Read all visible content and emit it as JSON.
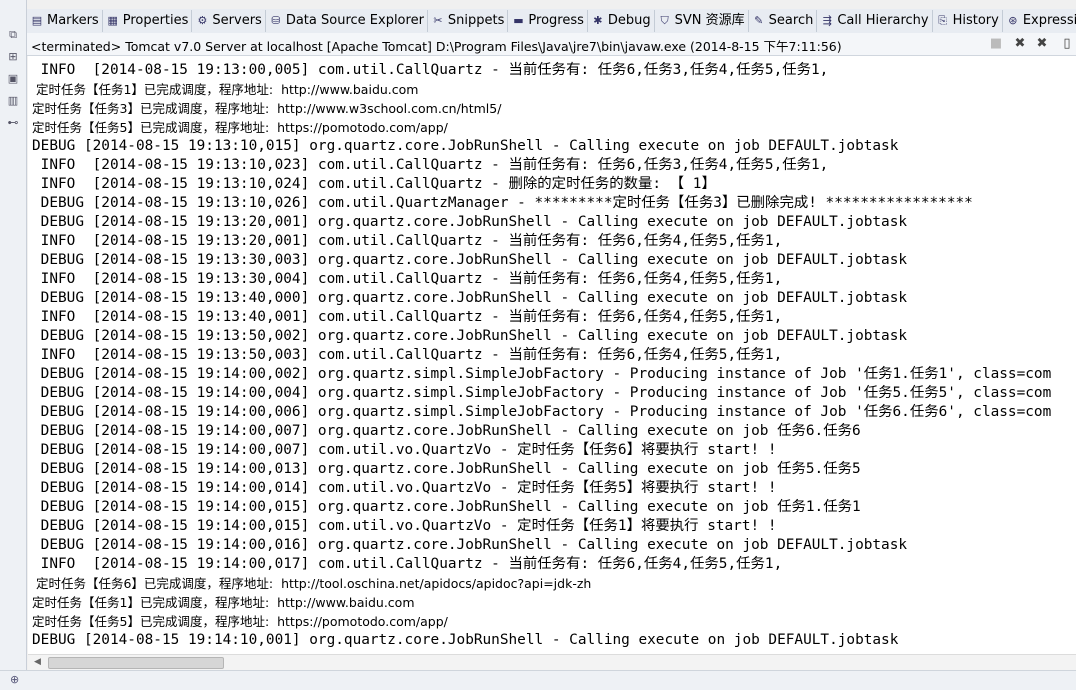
{
  "tabs": [
    {
      "label": "Markers",
      "icon": "markers-icon",
      "glyph": "▤"
    },
    {
      "label": "Properties",
      "icon": "properties-icon",
      "glyph": "▦"
    },
    {
      "label": "Servers",
      "icon": "servers-icon",
      "glyph": "⚙"
    },
    {
      "label": "Data Source Explorer",
      "icon": "database-icon",
      "glyph": "⛁"
    },
    {
      "label": "Snippets",
      "icon": "snippets-icon",
      "glyph": "✂"
    },
    {
      "label": "Progress",
      "icon": "progress-icon",
      "glyph": "▬"
    },
    {
      "label": "Debug",
      "icon": "debug-icon",
      "glyph": "✱"
    },
    {
      "label": "SVN 资源库",
      "icon": "svn-icon",
      "glyph": "⛉"
    },
    {
      "label": "Search",
      "icon": "search-icon",
      "glyph": "✎"
    },
    {
      "label": "Call Hierarchy",
      "icon": "call-hierarchy-icon",
      "glyph": "⇶"
    },
    {
      "label": "History",
      "icon": "history-icon",
      "glyph": "⎘"
    },
    {
      "label": "Expressions",
      "icon": "expressions-icon",
      "glyph": "⊛"
    }
  ],
  "console_title": "<terminated> Tomcat v7.0 Server at localhost [Apache Tomcat] D:\\Program Files\\Java\\jre7\\bin\\javaw.exe (2014-8-15 下午7:11:56)",
  "log_lines": [
    " INFO  [2014-08-15 19:13:00,005] com.util.CallQuartz - 当前任务有: 任务6,任务3,任务4,任务5,任务1,",
    " 定时任务【任务1】已完成调度，程序地址:  http://www.baidu.com",
    "定时任务【任务3】已完成调度，程序地址:  http://www.w3school.com.cn/html5/",
    "定时任务【任务5】已完成调度，程序地址:  https://pomotodo.com/app/",
    "DEBUG [2014-08-15 19:13:10,015] org.quartz.core.JobRunShell - Calling execute on job DEFAULT.jobtask",
    " INFO  [2014-08-15 19:13:10,023] com.util.CallQuartz - 当前任务有: 任务6,任务3,任务4,任务5,任务1,",
    " INFO  [2014-08-15 19:13:10,024] com.util.CallQuartz - 删除的定时任务的数量: 【 1】",
    " DEBUG [2014-08-15 19:13:10,026] com.util.QuartzManager - *********定时任务【任务3】已删除完成! *****************",
    " DEBUG [2014-08-15 19:13:20,001] org.quartz.core.JobRunShell - Calling execute on job DEFAULT.jobtask",
    " INFO  [2014-08-15 19:13:20,001] com.util.CallQuartz - 当前任务有: 任务6,任务4,任务5,任务1,",
    " DEBUG [2014-08-15 19:13:30,003] org.quartz.core.JobRunShell - Calling execute on job DEFAULT.jobtask",
    " INFO  [2014-08-15 19:13:30,004] com.util.CallQuartz - 当前任务有: 任务6,任务4,任务5,任务1,",
    " DEBUG [2014-08-15 19:13:40,000] org.quartz.core.JobRunShell - Calling execute on job DEFAULT.jobtask",
    " INFO  [2014-08-15 19:13:40,001] com.util.CallQuartz - 当前任务有: 任务6,任务4,任务5,任务1,",
    " DEBUG [2014-08-15 19:13:50,002] org.quartz.core.JobRunShell - Calling execute on job DEFAULT.jobtask",
    " INFO  [2014-08-15 19:13:50,003] com.util.CallQuartz - 当前任务有: 任务6,任务4,任务5,任务1,",
    " DEBUG [2014-08-15 19:14:00,002] org.quartz.simpl.SimpleJobFactory - Producing instance of Job '任务1.任务1', class=com",
    " DEBUG [2014-08-15 19:14:00,004] org.quartz.simpl.SimpleJobFactory - Producing instance of Job '任务5.任务5', class=com",
    " DEBUG [2014-08-15 19:14:00,006] org.quartz.simpl.SimpleJobFactory - Producing instance of Job '任务6.任务6', class=com",
    " DEBUG [2014-08-15 19:14:00,007] org.quartz.core.JobRunShell - Calling execute on job 任务6.任务6",
    " DEBUG [2014-08-15 19:14:00,007] com.util.vo.QuartzVo - 定时任务【任务6】将要执行 start! !",
    " DEBUG [2014-08-15 19:14:00,013] org.quartz.core.JobRunShell - Calling execute on job 任务5.任务5",
    " DEBUG [2014-08-15 19:14:00,014] com.util.vo.QuartzVo - 定时任务【任务5】将要执行 start! !",
    " DEBUG [2014-08-15 19:14:00,015] org.quartz.core.JobRunShell - Calling execute on job 任务1.任务1",
    " DEBUG [2014-08-15 19:14:00,015] com.util.vo.QuartzVo - 定时任务【任务1】将要执行 start! !",
    " DEBUG [2014-08-15 19:14:00,016] org.quartz.core.JobRunShell - Calling execute on job DEFAULT.jobtask",
    " INFO  [2014-08-15 19:14:00,017] com.util.CallQuartz - 当前任务有: 任务6,任务4,任务5,任务1,",
    " 定时任务【任务6】已完成调度，程序地址:  http://tool.oschina.net/apidocs/apidoc?api=jdk-zh",
    "定时任务【任务1】已完成调度，程序地址:  http://www.baidu.com",
    "定时任务【任务5】已完成调度，程序地址:  https://pomotodo.com/app/",
    "DEBUG [2014-08-15 19:14:10,001] org.quartz.core.JobRunShell - Calling execute on job DEFAULT.jobtask"
  ],
  "cn_line_indices": [
    1,
    2,
    3,
    27,
    28,
    29
  ]
}
